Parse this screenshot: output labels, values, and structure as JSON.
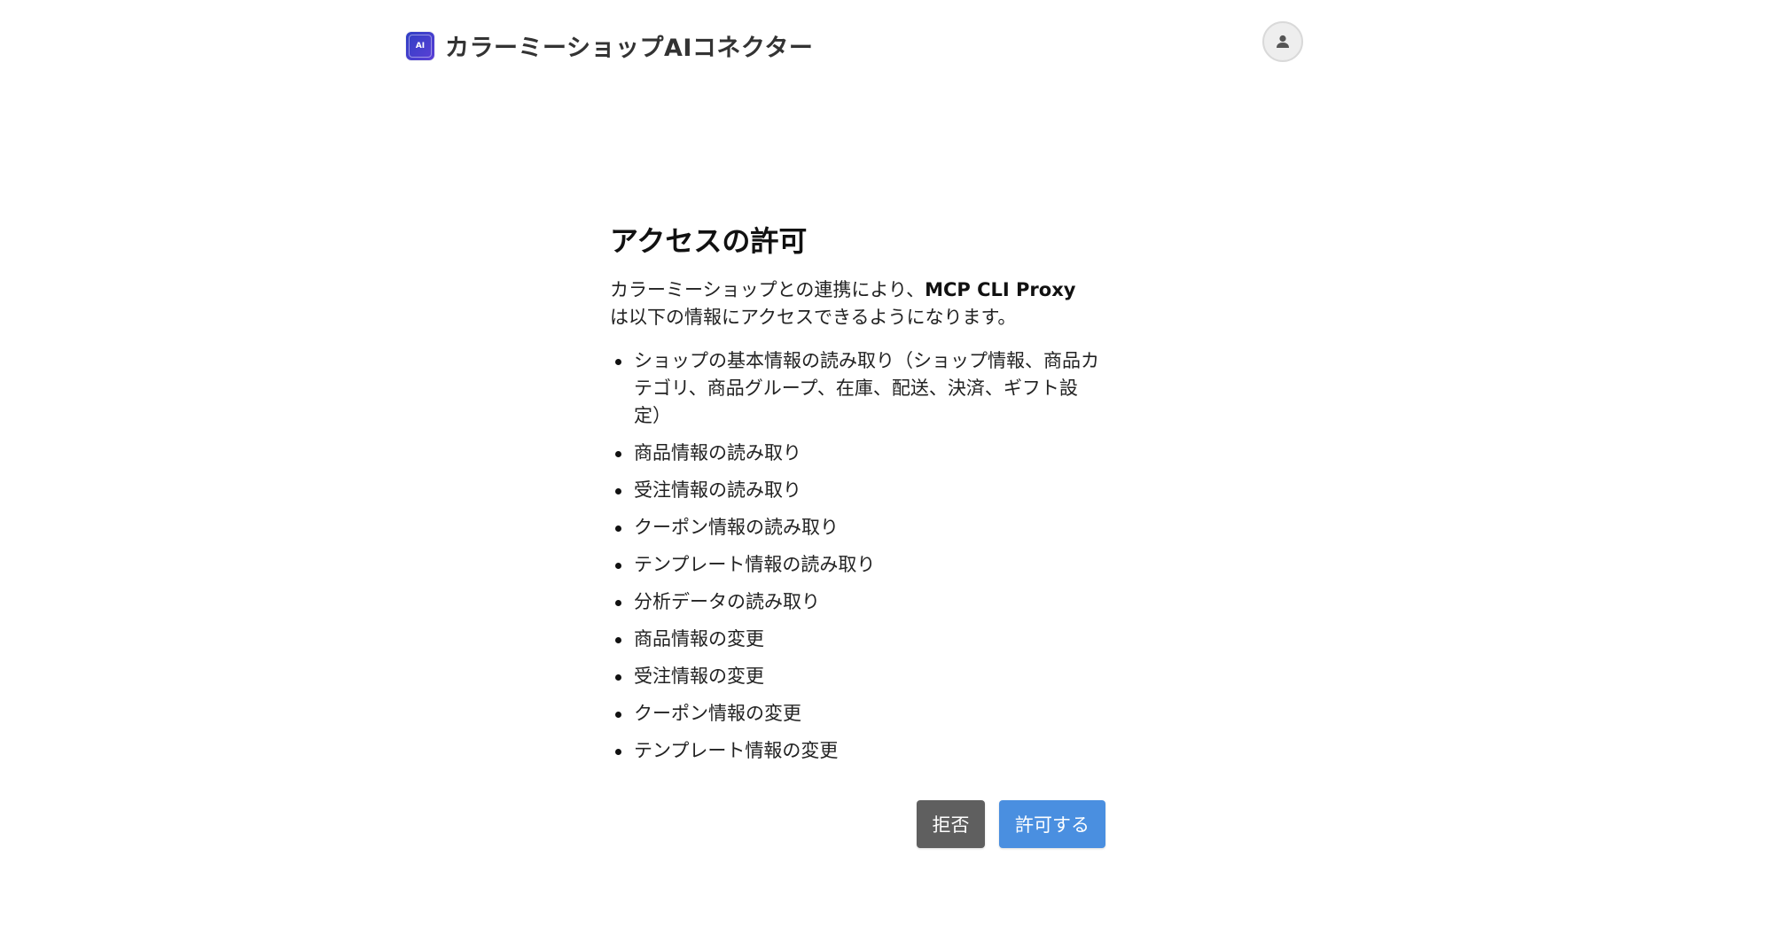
{
  "header": {
    "app_title": "カラーミーショップAIコネクター",
    "icon_text": "AI",
    "icon": "app-logo-icon",
    "account_icon": "user-icon"
  },
  "consent": {
    "title": "アクセスの許可",
    "intro_prefix": "カラーミーショップとの連携により、",
    "client_name": "MCP CLI Proxy",
    "intro_suffix": " は以下の情報にアクセスできるようになります。",
    "permissions": [
      "ショップの基本情報の読み取り（ショップ情報、商品カテゴリ、商品グループ、在庫、配送、決済、ギフト設定）",
      "商品情報の読み取り",
      "受注情報の読み取り",
      "クーポン情報の読み取り",
      "テンプレート情報の読み取り",
      "分析データの読み取り",
      "商品情報の変更",
      "受注情報の変更",
      "クーポン情報の変更",
      "テンプレート情報の変更"
    ],
    "deny_label": "拒否",
    "allow_label": "許可する"
  },
  "colors": {
    "deny_button": "#5f5f5f",
    "allow_button": "#4a8fe0"
  }
}
